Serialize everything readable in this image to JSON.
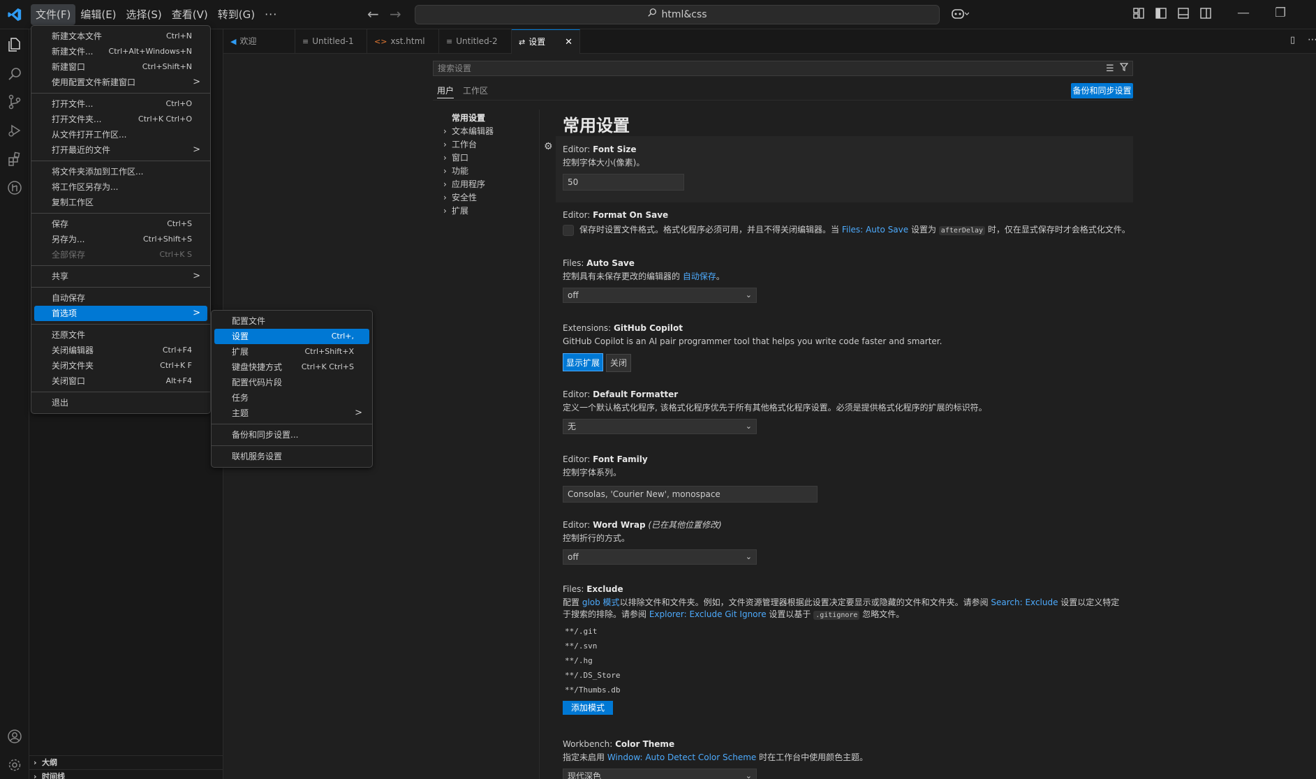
{
  "titlebar": {
    "menus": [
      "文件(F)",
      "编辑(E)",
      "选择(S)",
      "查看(V)",
      "转到(G)",
      "···"
    ],
    "search_text": "html&css"
  },
  "tabs": [
    {
      "label": "欢迎",
      "icon": "vscode-icon"
    },
    {
      "label": "Untitled-1",
      "icon": "lines-icon"
    },
    {
      "label": "xst.html",
      "icon": "html-icon"
    },
    {
      "label": "Untitled-2",
      "icon": "lines-icon"
    },
    {
      "label": "设置",
      "icon": "settings-icon",
      "close": "✕"
    }
  ],
  "sidebar": {
    "sections": [
      "大纲",
      "时间线"
    ]
  },
  "settings": {
    "search_placeholder": "搜索设置",
    "scope_user": "用户",
    "scope_workspace": "工作区",
    "backup_button": "备份和同步设置",
    "toc": [
      "常用设置",
      "文本编辑器",
      "工作台",
      "窗口",
      "功能",
      "应用程序",
      "安全性",
      "扩展"
    ],
    "heading": "常用设置",
    "font_size": {
      "prefix": "Editor: ",
      "name": "Font Size",
      "desc": "控制字体大小(像素)。",
      "value": "50"
    },
    "format_on_save": {
      "prefix": "Editor: ",
      "name": "Format On Save",
      "desc_a": "保存时设置文件格式。格式化程序必须可用，并且不得关闭编辑器。当 ",
      "desc_link": "Files: Auto Save",
      "desc_b": " 设置为 ",
      "desc_code": "afterDelay",
      "desc_c": " 时，仅在显式保存时才会格式化文件。"
    },
    "auto_save": {
      "prefix": "Files: ",
      "name": "Auto Save",
      "desc_a": "控制具有未保存更改的编辑器的 ",
      "desc_link": "自动保存",
      "desc_b": "。",
      "value": "off"
    },
    "copilot": {
      "prefix": "Extensions: ",
      "name": "GitHub Copilot",
      "desc": "GitHub Copilot is an AI pair programmer tool that helps you write code faster and smarter.",
      "btn_show": "显示扩展",
      "btn_close": "关闭"
    },
    "default_formatter": {
      "prefix": "Editor: ",
      "name": "Default Formatter",
      "desc": "定义一个默认格式化程序, 该格式化程序优先于所有其他格式化程序设置。必须是提供格式化程序的扩展的标识符。",
      "value": "无"
    },
    "font_family": {
      "prefix": "Editor: ",
      "name": "Font Family",
      "desc": "控制字体系列。",
      "value": "Consolas, 'Courier New', monospace"
    },
    "word_wrap": {
      "prefix": "Editor: ",
      "name": "Word Wrap",
      "modified": "(已在其他位置修改)",
      "desc": "控制折行的方式。",
      "value": "off"
    },
    "files_exclude": {
      "prefix": "Files: ",
      "name": "Exclude",
      "desc_a": "配置 ",
      "desc_link1": "glob 模式",
      "desc_b": "以排除文件和文件夹。例如，文件资源管理器根据此设置决定要显示或隐藏的文件和文件夹。请参阅 ",
      "desc_link2": "Search: Exclude",
      "desc_c": " 设置以定义特定于搜索的排除。请参阅 ",
      "desc_link3": "Explorer: Exclude Git Ignore",
      "desc_d": " 设置以基于 ",
      "desc_code": ".gitignore",
      "desc_e": " 忽略文件。",
      "patterns": [
        "**/.git",
        "**/.svn",
        "**/.hg",
        "**/.DS_Store",
        "**/Thumbs.db"
      ],
      "add_button": "添加模式"
    },
    "color_theme": {
      "prefix": "Workbench: ",
      "name": "Color Theme",
      "desc_a": "指定未启用 ",
      "desc_link": "Window: Auto Detect Color Scheme",
      "desc_b": " 时在工作台中使用颜色主题。",
      "value": "现代深色"
    }
  },
  "file_menu": {
    "groups": [
      [
        {
          "label": "新建文本文件",
          "kb": "Ctrl+N"
        },
        {
          "label": "新建文件...",
          "kb": "Ctrl+Alt+Windows+N"
        },
        {
          "label": "新建窗口",
          "kb": "Ctrl+Shift+N"
        },
        {
          "label": "使用配置文件新建窗口",
          "sub": ">"
        }
      ],
      [
        {
          "label": "打开文件...",
          "kb": "Ctrl+O"
        },
        {
          "label": "打开文件夹...",
          "kb": "Ctrl+K Ctrl+O"
        },
        {
          "label": "从文件打开工作区..."
        },
        {
          "label": "打开最近的文件",
          "sub": ">"
        }
      ],
      [
        {
          "label": "将文件夹添加到工作区..."
        },
        {
          "label": "将工作区另存为..."
        },
        {
          "label": "复制工作区"
        }
      ],
      [
        {
          "label": "保存",
          "kb": "Ctrl+S"
        },
        {
          "label": "另存为...",
          "kb": "Ctrl+Shift+S"
        },
        {
          "label": "全部保存",
          "kb": "Ctrl+K S",
          "disabled": true
        }
      ],
      [
        {
          "label": "共享",
          "sub": ">"
        }
      ],
      [
        {
          "label": "自动保存"
        },
        {
          "label": "首选项",
          "sub": ">",
          "selected": true
        }
      ],
      [
        {
          "label": "还原文件"
        },
        {
          "label": "关闭编辑器",
          "kb": "Ctrl+F4"
        },
        {
          "label": "关闭文件夹",
          "kb": "Ctrl+K F"
        },
        {
          "label": "关闭窗口",
          "kb": "Alt+F4"
        }
      ],
      [
        {
          "label": "退出"
        }
      ]
    ]
  },
  "pref_menu": {
    "groups": [
      [
        {
          "label": "配置文件"
        },
        {
          "label": "设置",
          "kb": "Ctrl+,",
          "selected": true
        },
        {
          "label": "扩展",
          "kb": "Ctrl+Shift+X"
        },
        {
          "label": "键盘快捷方式",
          "kb": "Ctrl+K Ctrl+S"
        },
        {
          "label": "配置代码片段"
        },
        {
          "label": "任务"
        },
        {
          "label": "主题",
          "sub": ">"
        }
      ],
      [
        {
          "label": "备份和同步设置..."
        }
      ],
      [
        {
          "label": "联机服务设置"
        }
      ]
    ]
  }
}
